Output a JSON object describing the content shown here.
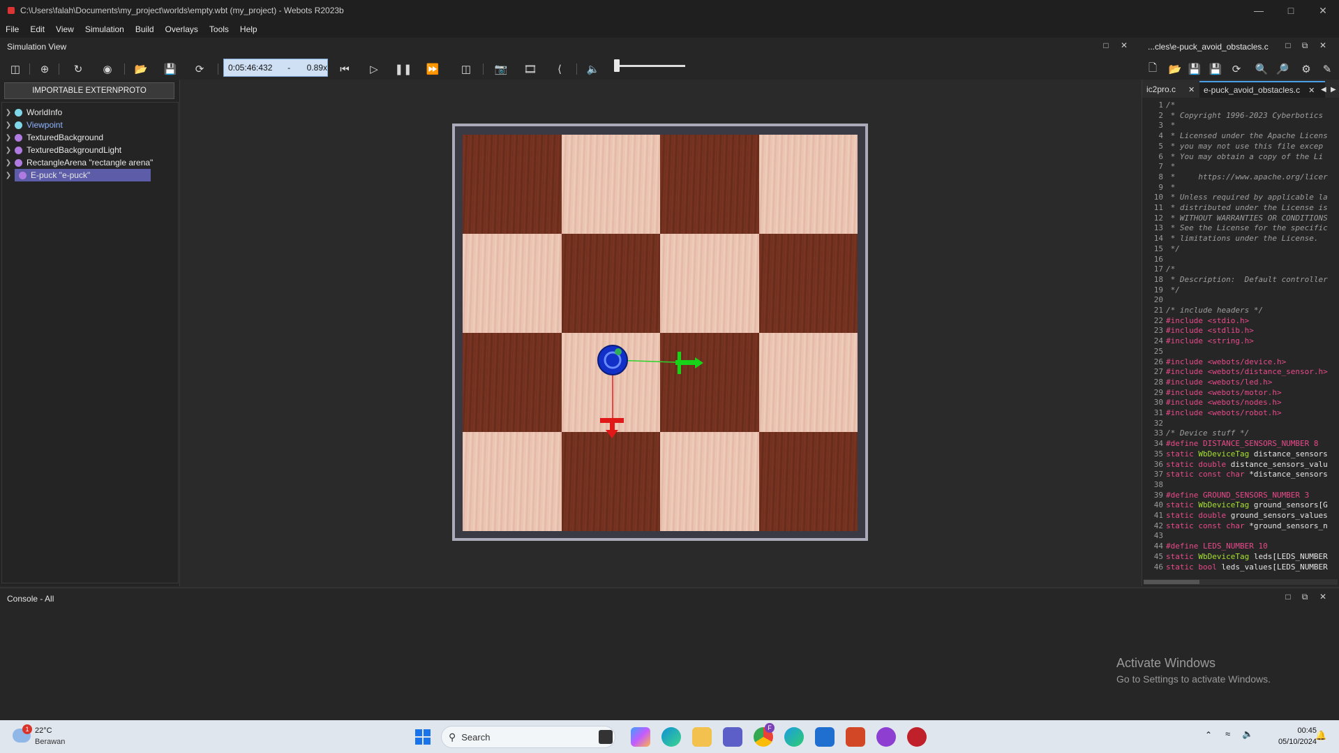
{
  "window": {
    "title": "C:\\Users\\falah\\Documents\\my_project\\worlds\\empty.wbt (my_project) - Webots R2023b",
    "minimize_icon": "minimize-icon",
    "maximize_icon": "maximize-icon",
    "close_icon": "close-icon"
  },
  "menu": {
    "items": [
      "File",
      "Edit",
      "View",
      "Simulation",
      "Build",
      "Overlays",
      "Tools",
      "Help"
    ]
  },
  "simulation_view": {
    "title": "Simulation View"
  },
  "editor_dock": {
    "title": "...cles\\e-puck_avoid_obstacles.c"
  },
  "toolbar": {
    "time": "0:05:46:432",
    "time_sep": "-",
    "speed": "0.89x",
    "volume_level": 0.0
  },
  "scene_tree": {
    "import_button": "IMPORTABLE EXTERNPROTO",
    "nodes": [
      {
        "label": "WorldInfo",
        "color": "#7ed6e8"
      },
      {
        "label": "Viewpoint",
        "color": "#7ed6e8",
        "accent": "#8fb4ff"
      },
      {
        "label": "TexturedBackground",
        "color": "#b07be0"
      },
      {
        "label": "TexturedBackgroundLight",
        "color": "#b07be0"
      },
      {
        "label": "RectangleArena \"rectangle arena\"",
        "color": "#b07be0"
      },
      {
        "label": "E-puck \"e-puck\"",
        "color": "#b07be0"
      }
    ]
  },
  "editor": {
    "tabs": [
      {
        "label": "ic2pro.c"
      },
      {
        "label": "e-puck_avoid_obstacles.c"
      }
    ],
    "lines": [
      {
        "n": "1",
        "t": "/*",
        "c": "cmt"
      },
      {
        "n": "2",
        "t": " * Copyright 1996-2023 Cyberbotics",
        "c": "cmt"
      },
      {
        "n": "3",
        "t": " *",
        "c": "cmt"
      },
      {
        "n": "4",
        "t": " * Licensed under the Apache Licens",
        "c": "cmt"
      },
      {
        "n": "5",
        "t": " * you may not use this file excep",
        "c": "cmt"
      },
      {
        "n": "6",
        "t": " * You may obtain a copy of the Li",
        "c": "cmt"
      },
      {
        "n": "7",
        "t": " *",
        "c": "cmt"
      },
      {
        "n": "8",
        "t": " *     https://www.apache.org/licer",
        "c": "cmt"
      },
      {
        "n": "9",
        "t": " *",
        "c": "cmt"
      },
      {
        "n": "10",
        "t": " * Unless required by applicable la",
        "c": "cmt"
      },
      {
        "n": "11",
        "t": " * distributed under the License is",
        "c": "cmt"
      },
      {
        "n": "12",
        "t": " * WITHOUT WARRANTIES OR CONDITIONS",
        "c": "cmt"
      },
      {
        "n": "13",
        "t": " * See the License for the specific",
        "c": "cmt"
      },
      {
        "n": "14",
        "t": " * limitations under the License.",
        "c": "cmt"
      },
      {
        "n": "15",
        "t": " */",
        "c": "cmt"
      },
      {
        "n": "16",
        "t": "",
        "c": "tx"
      },
      {
        "n": "17",
        "t": "/*",
        "c": "cmt"
      },
      {
        "n": "18",
        "t": " * Description:  Default controller",
        "c": "cmt"
      },
      {
        "n": "19",
        "t": " */",
        "c": "cmt"
      },
      {
        "n": "20",
        "t": "",
        "c": "tx"
      },
      {
        "n": "21",
        "t": "/* include headers */",
        "c": "cmt"
      },
      {
        "n": "22",
        "t": "#include <stdio.h>",
        "c": "pp"
      },
      {
        "n": "23",
        "t": "#include <stdlib.h>",
        "c": "pp"
      },
      {
        "n": "24",
        "t": "#include <string.h>",
        "c": "pp"
      },
      {
        "n": "25",
        "t": "",
        "c": "tx"
      },
      {
        "n": "26",
        "t": "#include <webots/device.h>",
        "c": "pp"
      },
      {
        "n": "27",
        "t": "#include <webots/distance_sensor.h>",
        "c": "pp"
      },
      {
        "n": "28",
        "t": "#include <webots/led.h>",
        "c": "pp"
      },
      {
        "n": "29",
        "t": "#include <webots/motor.h>",
        "c": "pp"
      },
      {
        "n": "30",
        "t": "#include <webots/nodes.h>",
        "c": "pp"
      },
      {
        "n": "31",
        "t": "#include <webots/robot.h>",
        "c": "pp"
      },
      {
        "n": "32",
        "t": "",
        "c": "tx"
      },
      {
        "n": "33",
        "t": "/* Device stuff */",
        "c": "cmt"
      },
      {
        "n": "34",
        "t": "#define DISTANCE_SENSORS_NUMBER 8",
        "c": "pp"
      },
      {
        "n": "35",
        "kw": "static ",
        "ty": "WbDeviceTag",
        "t": " distance_sensors",
        "c": "tx"
      },
      {
        "n": "36",
        "kw": "static double",
        "ty": "",
        "t": " distance_sensors_valu",
        "c": "tx"
      },
      {
        "n": "37",
        "kw": "static const char",
        "ty": "",
        "t": " *distance_sensors",
        "c": "tx"
      },
      {
        "n": "38",
        "t": "",
        "c": "tx"
      },
      {
        "n": "39",
        "t": "#define GROUND_SENSORS_NUMBER 3",
        "c": "pp"
      },
      {
        "n": "40",
        "kw": "static ",
        "ty": "WbDeviceTag",
        "t": " ground_sensors[G",
        "c": "tx"
      },
      {
        "n": "41",
        "kw": "static double",
        "ty": "",
        "t": " ground_sensors_values",
        "c": "tx"
      },
      {
        "n": "42",
        "kw": "static const char",
        "ty": "",
        "t": " *ground_sensors_n",
        "c": "tx"
      },
      {
        "n": "43",
        "t": "",
        "c": "tx"
      },
      {
        "n": "44",
        "t": "#define LEDS_NUMBER 10",
        "c": "pp"
      },
      {
        "n": "45",
        "kw": "static ",
        "ty": "WbDeviceTag",
        "t": " leds[LEDS_NUMBER",
        "c": "tx"
      },
      {
        "n": "46",
        "kw": "static bool",
        "ty": "",
        "t": " leds_values[LEDS_NUMBER",
        "c": "tx"
      }
    ]
  },
  "console": {
    "title": "Console - All"
  },
  "watermark": {
    "line1": "Activate Windows",
    "line2": "Go to Settings to activate Windows."
  },
  "taskbar": {
    "weather_temp": "22°C",
    "weather_desc": "Berawan",
    "weather_badge": "1",
    "search_placeholder": "Search",
    "time": "00:45",
    "date": "05/10/2024",
    "chrome_badge": "F"
  }
}
